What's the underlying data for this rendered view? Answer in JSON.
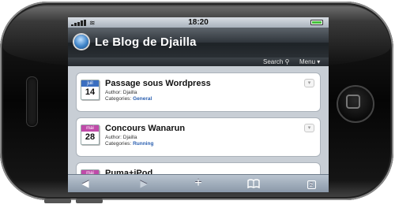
{
  "status_bar": {
    "time": "18:20",
    "battery_level": 1.0
  },
  "header": {
    "title": "Le Blog de Djailla"
  },
  "subnav": {
    "search_label": "Search",
    "menu_label": "Menu"
  },
  "posts": [
    {
      "month": "juil",
      "day": "14",
      "title": "Passage sous Wordpress",
      "author_label": "Author:",
      "author": "Djailla",
      "categories_label": "Categories:",
      "category": "General",
      "month_color": "#3b6fc0"
    },
    {
      "month": "mai",
      "day": "28",
      "title": "Concours Wanarun",
      "author_label": "Author:",
      "author": "Djailla",
      "categories_label": "Categories:",
      "category": "Running",
      "month_color": "#c04aa9"
    },
    {
      "month": "mai",
      "day": "",
      "title": "Puma+iPod",
      "month_color": "#c04aa9"
    }
  ],
  "toolbar": {
    "back_icon": "◀",
    "forward_icon": "▶",
    "add_icon": "+",
    "bookmarks_icon": "book-icon",
    "pages_count": "2"
  }
}
